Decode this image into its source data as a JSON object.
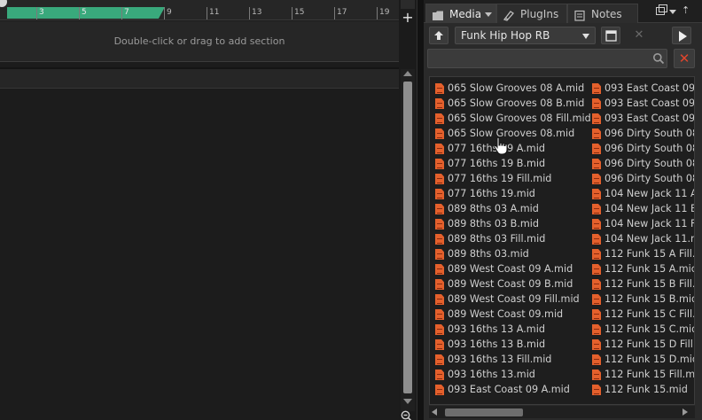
{
  "ruler": {
    "bars": [
      "3",
      "5",
      "7",
      "9",
      "11",
      "13",
      "15",
      "17",
      "19"
    ]
  },
  "arranger": {
    "hint": "Double-click or drag to add section"
  },
  "browser": {
    "tabs": [
      {
        "label": "Media",
        "icon": "folder-icon"
      },
      {
        "label": "PlugIns",
        "icon": "plugin-icon"
      },
      {
        "label": "Notes",
        "icon": "notes-icon"
      }
    ],
    "preset": "Funk Hip Hop RB",
    "search": {
      "value": "",
      "placeholder": ""
    },
    "files_col1": [
      "065 Slow Grooves 08 A.mid",
      "065 Slow Grooves 08 B.mid",
      "065 Slow Grooves 08 Fill.mid",
      "065 Slow Grooves 08.mid",
      "077 16ths 19 A.mid",
      "077 16ths 19 B.mid",
      "077 16ths 19 Fill.mid",
      "077 16ths 19.mid",
      "089 8ths 03 A.mid",
      "089 8ths 03 B.mid",
      "089 8ths 03 Fill.mid",
      "089 8ths 03.mid",
      "089 West Coast 09 A.mid",
      "089 West Coast 09 B.mid",
      "089 West Coast 09 Fill.mid",
      "089 West Coast 09.mid",
      "093 16ths 13 A.mid",
      "093 16ths 13 B.mid",
      "093 16ths 13 Fill.mid",
      "093 16ths 13.mid",
      "093 East Coast 09 A.mid"
    ],
    "files_col2": [
      "093 East Coast 09",
      "093 East Coast 09",
      "093 East Coast 09.",
      "096 Dirty South 08",
      "096 Dirty South 08",
      "096 Dirty South 08",
      "096 Dirty South 08",
      "104 New Jack 11 A",
      "104 New Jack 11 B",
      "104 New Jack 11 F",
      "104 New Jack 11.m",
      "112 Funk 15 A Fill.",
      "112 Funk 15 A.mic",
      "112 Funk 15 B Fill.",
      "112 Funk 15 B.mid",
      "112 Funk 15 C Fill.",
      "112 Funk 15 C.mid",
      "112 Funk 15 D Fill.",
      "112 Funk 15 D.mid",
      "112 Funk 15 Fill.m",
      "112 Funk 15.mid"
    ]
  },
  "colors": {
    "loop_bar": "#39a97c",
    "file_icon": "#e4602c",
    "clear_x": "#e0452c"
  }
}
